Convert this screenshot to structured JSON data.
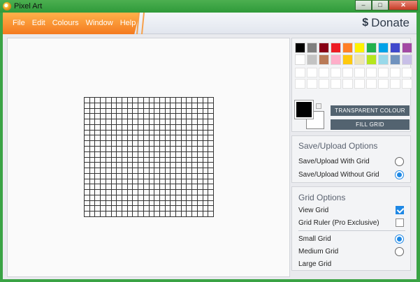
{
  "window": {
    "title": "Pixel Art",
    "minimize": "–",
    "maximize": "□",
    "close": "✕"
  },
  "menu": [
    "File",
    "Edit",
    "Colours",
    "Window",
    "Help"
  ],
  "donate": {
    "icon": "$",
    "label": "Donate"
  },
  "canvas": {
    "cols": 24,
    "rows": 22
  },
  "palette": {
    "colors_row1": [
      "#000000",
      "#7f7f7f",
      "#880015",
      "#ed1c24",
      "#ff7f27",
      "#fff200",
      "#22b14c",
      "#00a2e8",
      "#3f48cc",
      "#a349a4"
    ],
    "colors_row2": [
      "#ffffff",
      "#c3c3c3",
      "#b97a57",
      "#ffaec9",
      "#ffc90e",
      "#efe4b0",
      "#b5e61d",
      "#99d9ea",
      "#7092be",
      "#c8bfe7"
    ],
    "custom_rows": 2,
    "primary": "#000000",
    "secondary": "#ffffff",
    "transparent_label": "TRANSPARENT COLOUR",
    "fill_label": "FILL GRID"
  },
  "upload": {
    "title": "Save/Upload Options",
    "with_grid": "Save/Upload With Grid",
    "without_grid": "Save/Upload Without Grid"
  },
  "grid_options": {
    "title": "Grid Options",
    "view_grid": "View Grid",
    "grid_ruler": "Grid Ruler (Pro Exclusive)",
    "small": "Small Grid",
    "medium": "Medium Grid",
    "large": "Large Grid"
  }
}
